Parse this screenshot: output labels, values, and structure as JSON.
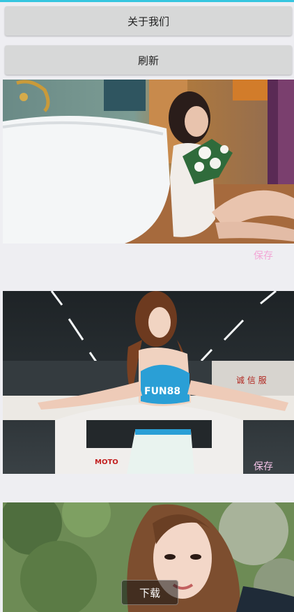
{
  "buttons": {
    "about": "关于我们",
    "refresh": "刷新",
    "download": "下载"
  },
  "cards": [
    {
      "save_label": "保存"
    },
    {
      "save_label": "保存"
    }
  ],
  "photo2_signage": {
    "shirt_logo": "FUN88",
    "car_text": "MOTO",
    "wall_text": "诚 信 服"
  },
  "colors": {
    "accent_line": "#35c6df",
    "save_text": "#f3a6d6",
    "button_bg": "#d7d8d8",
    "page_bg": "#eeeef2"
  }
}
